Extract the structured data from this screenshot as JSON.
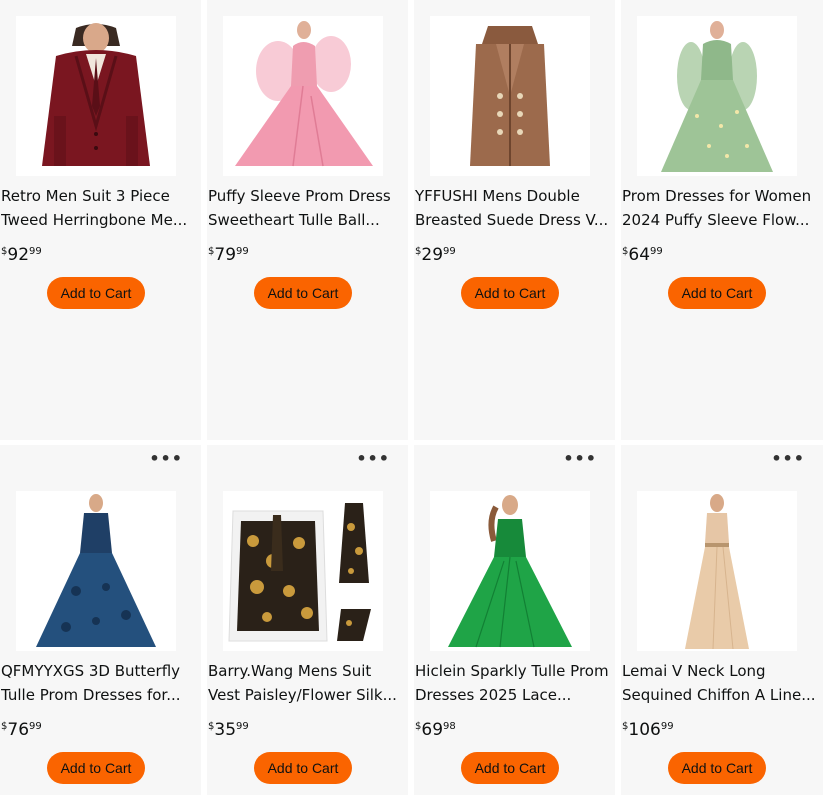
{
  "products": [
    {
      "title_1": "Retro Men Suit 3 Piece",
      "title_2": "Tweed Herringbone Me...",
      "price_symbol": "$",
      "price_whole": "92",
      "price_fraction": "99",
      "cart_label": "Add to Cart",
      "image_icon": "burgundy-suit-image",
      "show_more": false
    },
    {
      "title_1": "Puffy Sleeve Prom Dress",
      "title_2": "Sweetheart Tulle Ball...",
      "price_symbol": "$",
      "price_whole": "79",
      "price_fraction": "99",
      "cart_label": "Add to Cart",
      "image_icon": "pink-gown-image",
      "show_more": false
    },
    {
      "title_1": "YFFUSHI Mens Double",
      "title_2": "Breasted Suede Dress V...",
      "price_symbol": "$",
      "price_whole": "29",
      "price_fraction": "99",
      "cart_label": "Add to Cart",
      "image_icon": "brown-vest-image",
      "show_more": false
    },
    {
      "title_1": "Prom Dresses for Women",
      "title_2": "2024 Puffy Sleeve Flow...",
      "price_symbol": "$",
      "price_whole": "64",
      "price_fraction": "99",
      "cart_label": "Add to Cart",
      "image_icon": "green-gown-image",
      "show_more": false
    },
    {
      "title_1": "QFMYYXGS 3D Butterfly",
      "title_2": "Tulle Prom Dresses for...",
      "price_symbol": "$",
      "price_whole": "76",
      "price_fraction": "99",
      "cart_label": "Add to Cart",
      "image_icon": "navy-gown-image",
      "show_more": true
    },
    {
      "title_1": "Barry.Wang Mens Suit",
      "title_2": "Vest Paisley/Flower Silk...",
      "price_symbol": "$",
      "price_whole": "35",
      "price_fraction": "99",
      "cart_label": "Add to Cart",
      "image_icon": "paisley-vest-set-image",
      "show_more": true
    },
    {
      "title_1": "Hiclein Sparkly Tulle Prom",
      "title_2": "Dresses 2025 Lace...",
      "price_symbol": "$",
      "price_whole": "69",
      "price_fraction": "98",
      "cart_label": "Add to Cart",
      "image_icon": "emerald-gown-image",
      "show_more": true
    },
    {
      "title_1": "Lemai V Neck Long",
      "title_2": "Sequined Chiffon A Line...",
      "price_symbol": "$",
      "price_whole": "106",
      "price_fraction": "99",
      "cart_label": "Add to Cart",
      "image_icon": "champagne-gown-image",
      "show_more": true
    }
  ],
  "more_options_icon": "more-options-icon",
  "colors": {
    "button_bg": "#fa6400",
    "card_bg": "#f7f7f7",
    "text": "#0f1111"
  }
}
